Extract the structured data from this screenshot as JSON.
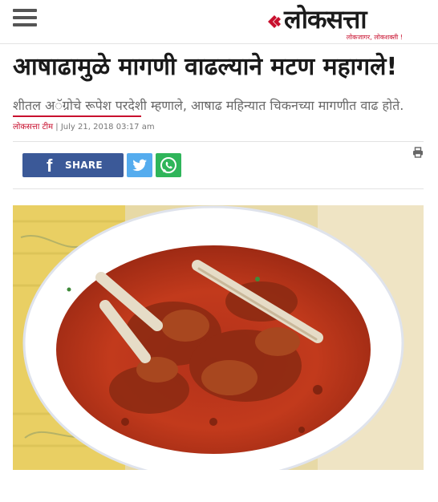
{
  "header": {
    "logo_text": "लोकसत्ता",
    "logo_tagline": "लोकजागर, लोकशक्ती !"
  },
  "article": {
    "headline": "आषाढामुळे मागणी वाढल्याने मटण महागले!",
    "subheading": "शीतल अॅग्रोचे रूपेश परदेशी म्हणाले, आषाढ महिन्यात चिकनच्या मागणीत वाढ होते.",
    "author": "लोकसत्ता टीम",
    "date": "| July 21, 2018 03:17 am"
  },
  "share": {
    "facebook_label": "SHARE"
  },
  "colors": {
    "brand_red": "#c8102e",
    "facebook": "#3b5998",
    "twitter": "#55acee",
    "whatsapp": "#2fb55a"
  },
  "icons": [
    "menu-icon",
    "facebook-icon",
    "twitter-icon",
    "whatsapp-icon",
    "print-icon"
  ]
}
